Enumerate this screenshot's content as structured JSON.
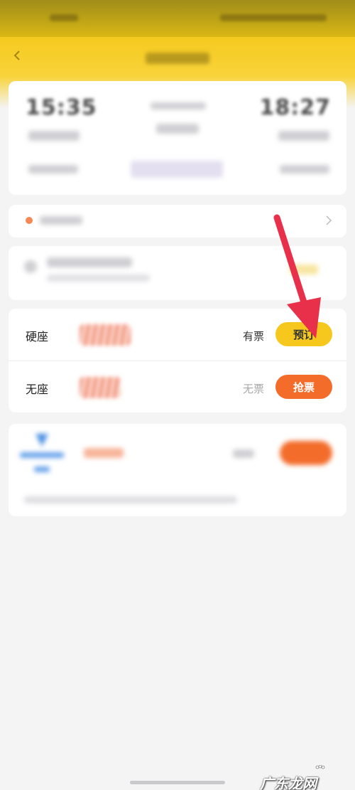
{
  "seats": [
    {
      "name": "硬座",
      "status": "有票",
      "button": "预订",
      "status_color": "#333333"
    },
    {
      "name": "无座",
      "status": "无票",
      "button": "抢票",
      "status_color": "#a8a8a8"
    }
  ],
  "watermark": "广东龙网",
  "colors": {
    "header_yellow": "#f5ca1f",
    "book_button": "#f6c81d",
    "grab_button": "#f36c2a",
    "arrow": "#e8304a",
    "accent_orange": "#f36c2a"
  },
  "icons": [
    "back-icon",
    "train-arrow-icon",
    "star-icon",
    "insurance-icon",
    "chevron-right-icon",
    "brand-logo-icon"
  ]
}
